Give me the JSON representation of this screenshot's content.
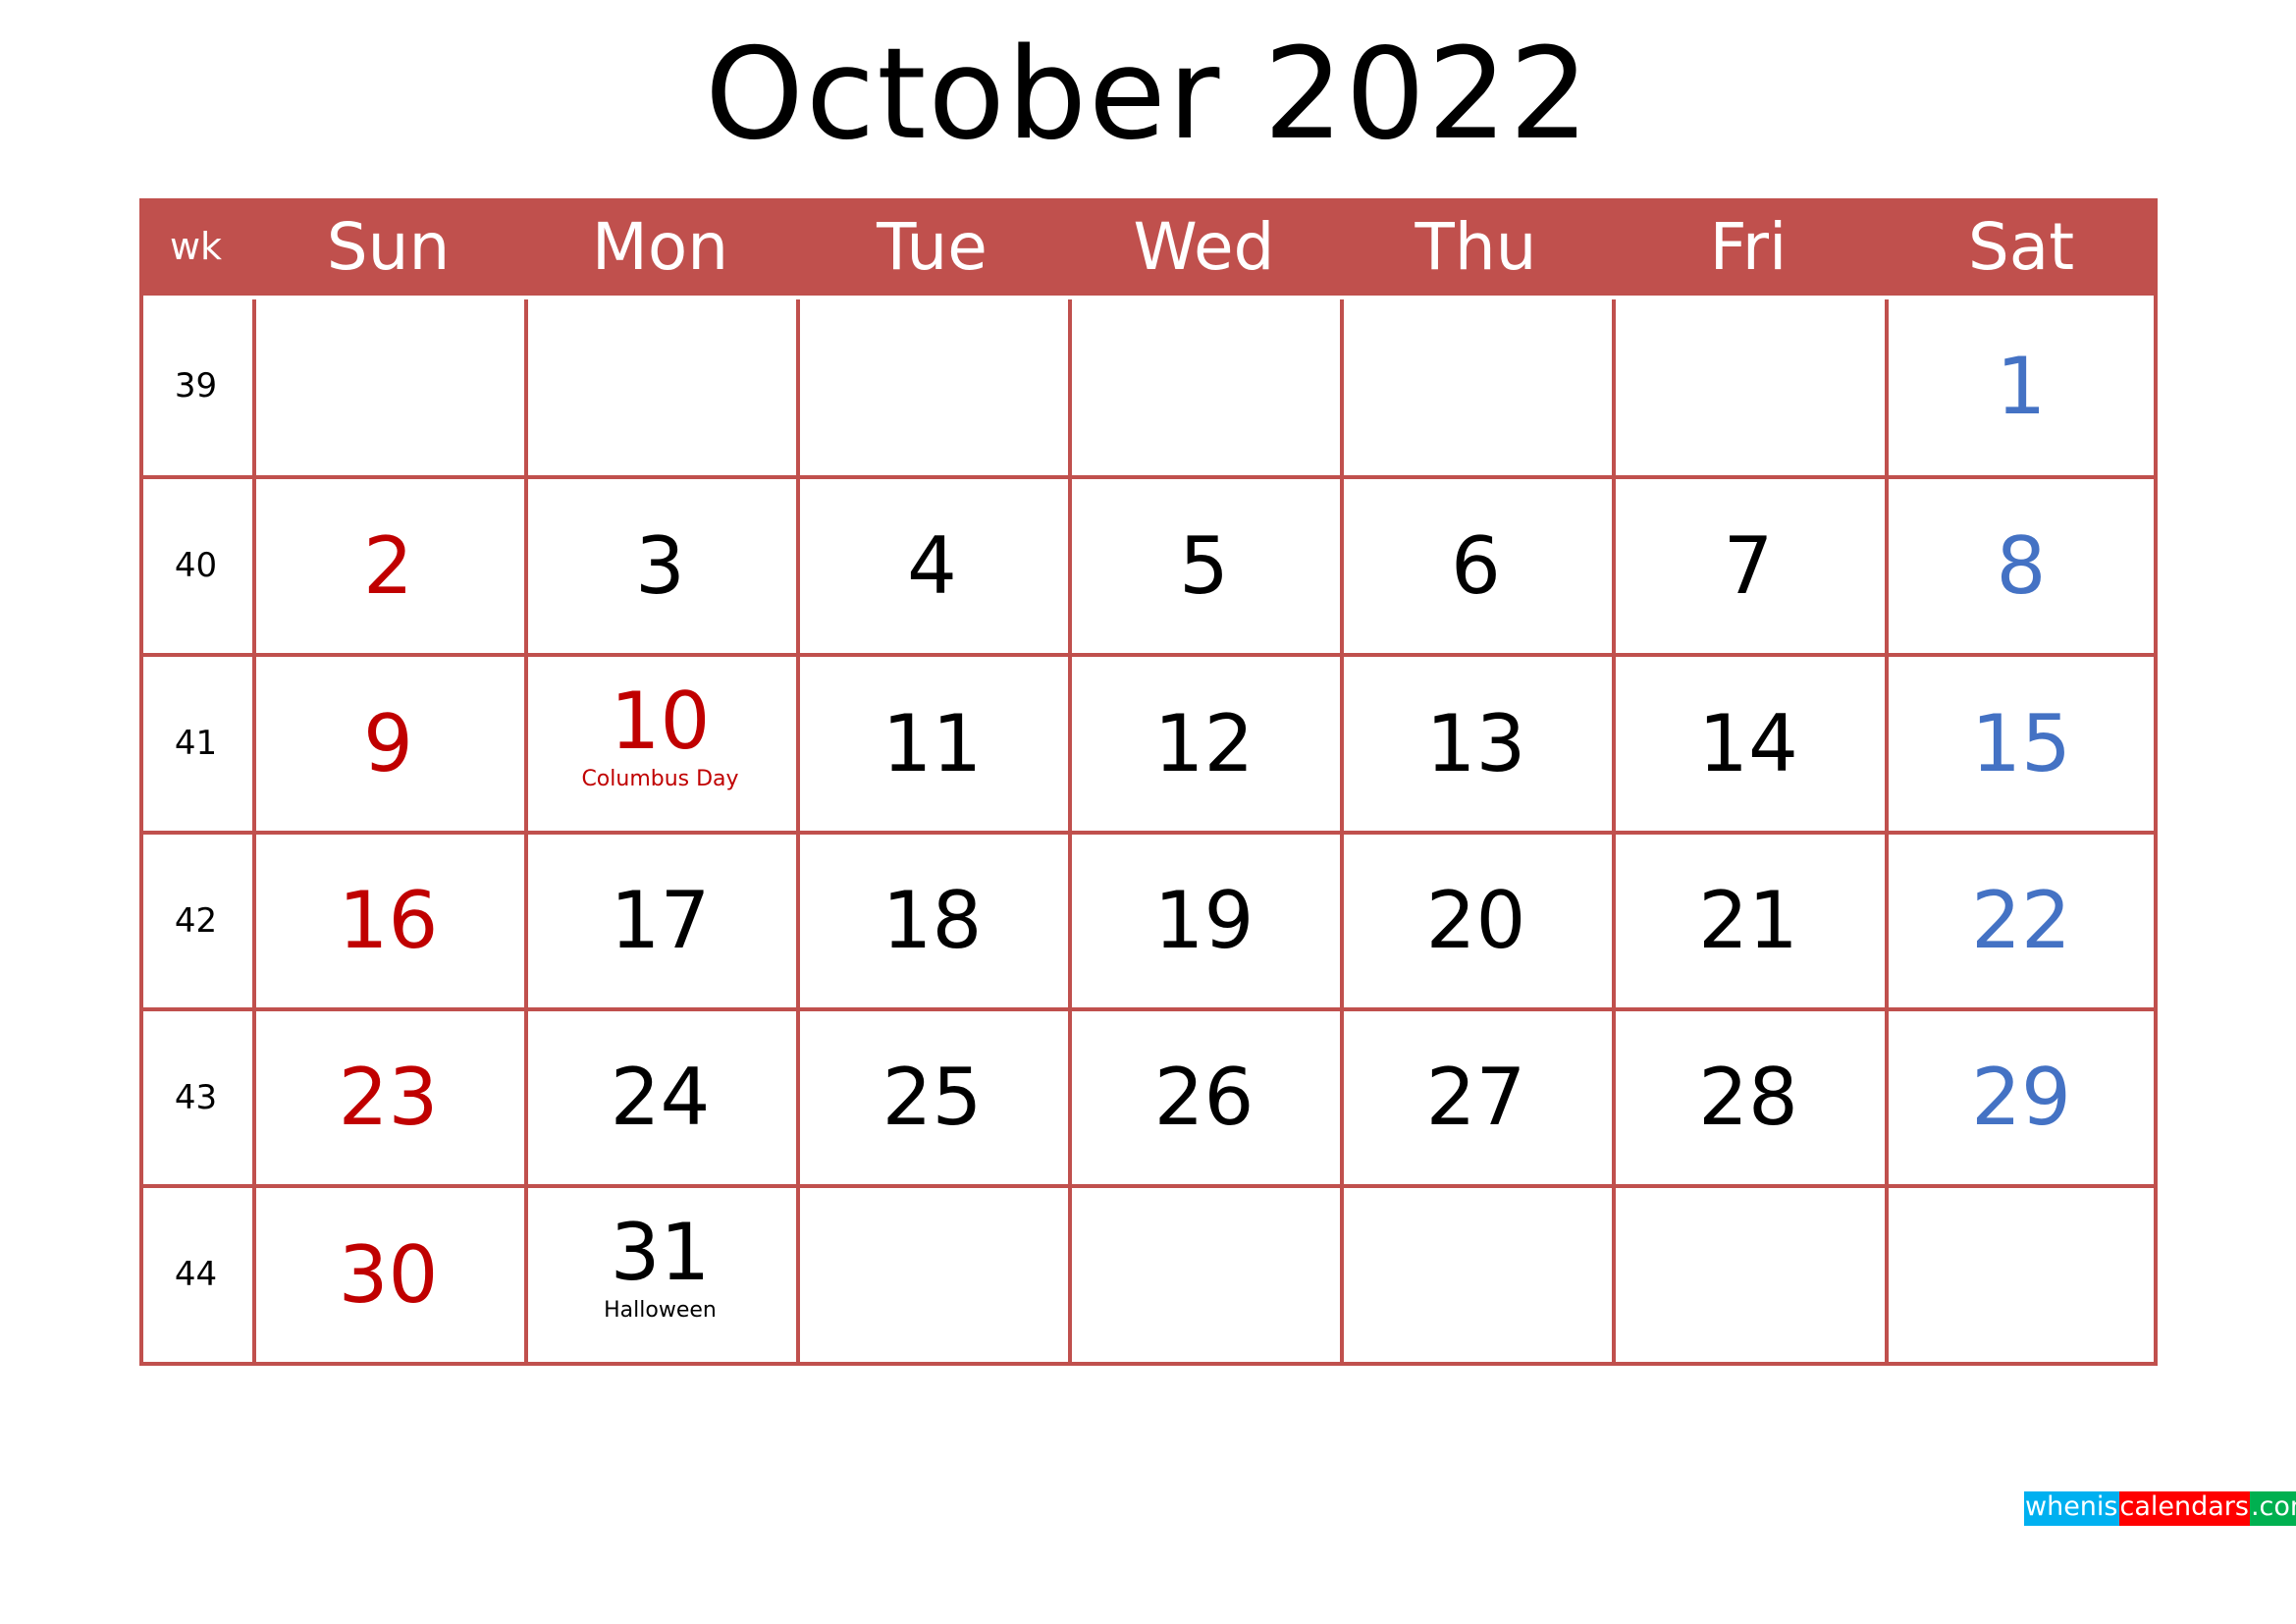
{
  "title": "October 2022",
  "colors": {
    "header_bg": "#C0504D",
    "grid_line": "#C0504D",
    "sunday": "#C00000",
    "saturday": "#4472C4",
    "weekday": "#000000",
    "holiday_red": "#C00000"
  },
  "header": {
    "week_label": "wk",
    "days": [
      "Sun",
      "Mon",
      "Tue",
      "Wed",
      "Thu",
      "Fri",
      "Sat"
    ]
  },
  "weeks": [
    {
      "wk": "39",
      "days": [
        "",
        "",
        "",
        "",
        "",
        "",
        "1"
      ]
    },
    {
      "wk": "40",
      "days": [
        "2",
        "3",
        "4",
        "5",
        "6",
        "7",
        "8"
      ]
    },
    {
      "wk": "41",
      "days": [
        "9",
        "10",
        "11",
        "12",
        "13",
        "14",
        "15"
      ]
    },
    {
      "wk": "42",
      "days": [
        "16",
        "17",
        "18",
        "19",
        "20",
        "21",
        "22"
      ]
    },
    {
      "wk": "43",
      "days": [
        "23",
        "24",
        "25",
        "26",
        "27",
        "28",
        "29"
      ]
    },
    {
      "wk": "44",
      "days": [
        "30",
        "31",
        "",
        "",
        "",
        "",
        ""
      ]
    }
  ],
  "holidays": [
    {
      "week": 2,
      "day": 1,
      "name": "Columbus Day",
      "style": "red",
      "date_style": "sun"
    },
    {
      "week": 5,
      "day": 1,
      "name": "Halloween",
      "style": "black",
      "date_style": "week"
    }
  ],
  "watermark": {
    "parts": [
      {
        "text": "whenis",
        "bg": "#00B0F0"
      },
      {
        "text": "calendars",
        "bg": "#FF0000"
      },
      {
        "text": ".com",
        "bg": "#00B050"
      }
    ]
  }
}
